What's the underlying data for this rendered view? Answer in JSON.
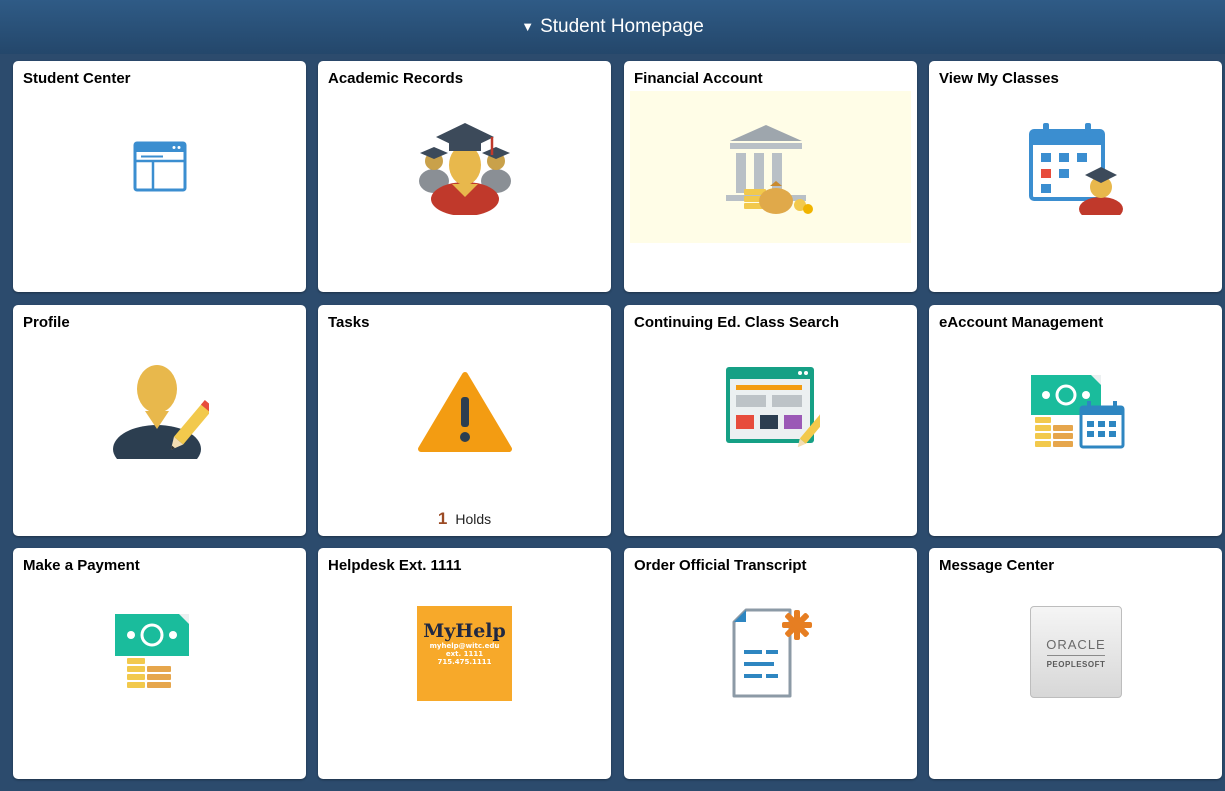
{
  "header": {
    "title": "Student Homepage",
    "caret": "▼"
  },
  "tiles": [
    {
      "title": "Student Center",
      "icon": "browser-window-icon"
    },
    {
      "title": "Academic Records",
      "icon": "graduates-icon"
    },
    {
      "title": "Financial Account",
      "icon": "bank-money-icon",
      "background": "#fffde7"
    },
    {
      "title": "View My Classes",
      "icon": "calendar-student-icon"
    },
    {
      "title": "Profile",
      "icon": "user-edit-icon"
    },
    {
      "title": "Tasks",
      "icon": "warning-icon",
      "count": "1",
      "count_label": "Holds"
    },
    {
      "title": "Continuing Ed. Class Search",
      "icon": "class-search-icon"
    },
    {
      "title": "eAccount Management",
      "icon": "money-calendar-icon"
    },
    {
      "title": "Make a Payment",
      "icon": "money-coins-icon"
    },
    {
      "title": "Helpdesk Ext. 1111",
      "icon": "myhelp-logo",
      "logo_text": [
        "MyHelp",
        "myhelp@witc.edu",
        "ext. 1111",
        "715.475.1111"
      ]
    },
    {
      "title": "Order Official Transcript",
      "icon": "transcript-document-icon"
    },
    {
      "title": "Message Center",
      "icon": "oracle-peoplesoft-logo",
      "logo_text": [
        "ORACLE",
        "PEOPLESOFT"
      ]
    }
  ],
  "colors": {
    "header": "#2c5682",
    "background": "#2c4b6d",
    "tile": "#ffffff",
    "count": "#9b4a24"
  }
}
